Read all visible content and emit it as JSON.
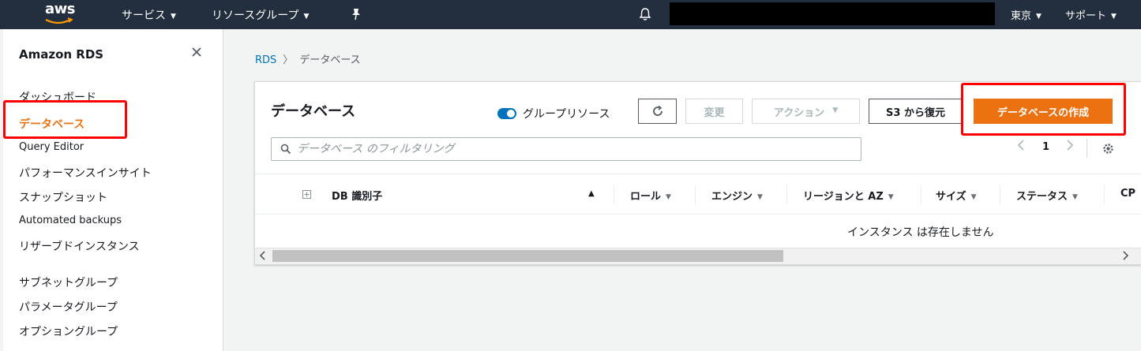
{
  "topnav": {
    "logo_text": "aws",
    "services": "サービス",
    "resource_groups": "リソースグループ",
    "region": "東京",
    "support": "サポート",
    "icons": [
      "pin-icon",
      "bell-icon"
    ]
  },
  "sidebar": {
    "title": "Amazon RDS",
    "items": [
      {
        "label": "ダッシュボード"
      },
      {
        "label": "データベース"
      },
      {
        "label": "Query Editor"
      },
      {
        "label": "パフォーマンスインサイト"
      },
      {
        "label": "スナップショット"
      },
      {
        "label": "Automated backups"
      },
      {
        "label": "リザーブドインスタンス"
      },
      {
        "label": "サブネットグループ"
      },
      {
        "label": "パラメータグループ"
      },
      {
        "label": "オプショングループ"
      }
    ],
    "active_index": 1
  },
  "breadcrumb": {
    "root": "RDS",
    "current": "データベース"
  },
  "panel": {
    "title": "データベース",
    "group_resources_label": "グループリソース",
    "group_resources_on": true,
    "buttons": {
      "modify": "変更",
      "actions": "アクション",
      "restore_s3": "S3 から復元",
      "create": "データベースの作成"
    },
    "filter_placeholder": "データベース のフィルタリング",
    "page_number": "1",
    "columns": [
      "DB 識別子",
      "ロール",
      "エンジン",
      "リージョンと AZ",
      "サイズ",
      "ステータス",
      "CP"
    ],
    "empty_message": "インスタンス は存在しません"
  },
  "colors": {
    "nav_bg": "#232f3e",
    "accent_orange": "#ec7211",
    "link_blue": "#0073bb",
    "highlight_red": "#ff0000"
  }
}
